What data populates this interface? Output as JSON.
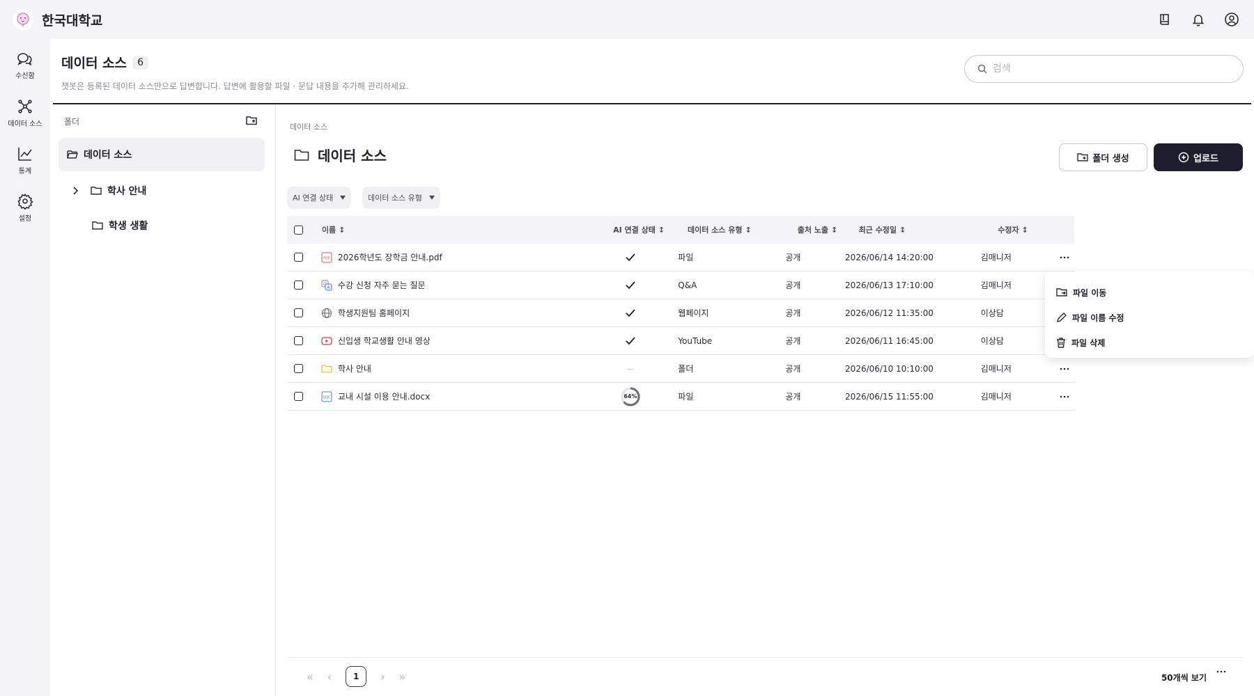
{
  "brand": {
    "name": "한국대학교"
  },
  "nav": [
    {
      "label": "수신함",
      "icon": "inbox-chat-icon"
    },
    {
      "label": "데이터 소스",
      "icon": "data-source-icon"
    },
    {
      "label": "통계",
      "icon": "chart-icon"
    },
    {
      "label": "설정",
      "icon": "gear-icon"
    }
  ],
  "header": {
    "title": "데이터 소스",
    "count": "6",
    "subtitle": "챗봇은 등록된 데이터 소스만으로 답변합니다. 답변에 활용할 파일 · 문답 내용을 추가해 관리하세요.",
    "search_placeholder": "검색"
  },
  "folders": {
    "heading": "폴더",
    "items": [
      {
        "label": "데이터 소스"
      },
      {
        "label": "학사 안내"
      },
      {
        "label": "학생 생활"
      }
    ]
  },
  "content": {
    "breadcrumb": "데이터 소스",
    "title": "데이터 소스",
    "create_folder_label": "폴더 생성",
    "upload_label": "업로드",
    "filters": [
      "AI 연결 상태",
      "데이터 소스 유형"
    ]
  },
  "table": {
    "columns": [
      "이름",
      "AI 연결 상태",
      "데이터 소스 유형",
      "출처 노출",
      "최근 수정일",
      "수정자"
    ],
    "rows": [
      {
        "name": "2026학년도 장학금 안내.pdf",
        "icon": "pdf-icon",
        "ai": "check",
        "type": "파일",
        "exposure": "공개",
        "date": "2026/06/14 14:20:00",
        "modifier": "김매니저"
      },
      {
        "name": "수강 신청 자주 묻는 질문",
        "icon": "qa-icon",
        "ai": "check",
        "type": "Q&A",
        "exposure": "공개",
        "date": "2026/06/13 17:10:00",
        "modifier": "김매니저"
      },
      {
        "name": "학생지원팀 홈페이지",
        "icon": "globe-icon",
        "ai": "check",
        "type": "웹페이지",
        "exposure": "공개",
        "date": "2026/06/12 11:35:00",
        "modifier": "이상담"
      },
      {
        "name": "신입생 학교생활 안내 영상",
        "icon": "youtube-icon",
        "ai": "check",
        "type": "YouTube",
        "exposure": "공개",
        "date": "2026/06/11 16:45:00",
        "modifier": "이상담"
      },
      {
        "name": "학사 안내",
        "icon": "folder-icon",
        "ai": "none",
        "ai_text": "—",
        "type": "폴더",
        "exposure": "공개",
        "date": "2026/06/10 10:10:00",
        "modifier": "김매니저"
      },
      {
        "name": "교내 시설 이용 안내.docx",
        "icon": "doc-icon",
        "ai": "progress",
        "ai_text": "64%",
        "progress": 0.64,
        "type": "파일",
        "exposure": "공개",
        "date": "2026/06/15 11:55:00",
        "modifier": "김매니저"
      }
    ]
  },
  "context_menu": [
    {
      "label": "파일 이동",
      "icon": "move-folder-icon"
    },
    {
      "label": "파일 이름 수정",
      "icon": "pencil-icon"
    },
    {
      "label": "파일 삭제",
      "icon": "trash-icon"
    }
  ],
  "pagination": {
    "current": "1",
    "per_page": "50개씩 보기"
  },
  "colors": {
    "primary": "#1d1d2e",
    "pdf": "#e05a5a",
    "youtube": "#e53935",
    "folder": "#f2c94c",
    "doc": "#4a7bd1"
  }
}
